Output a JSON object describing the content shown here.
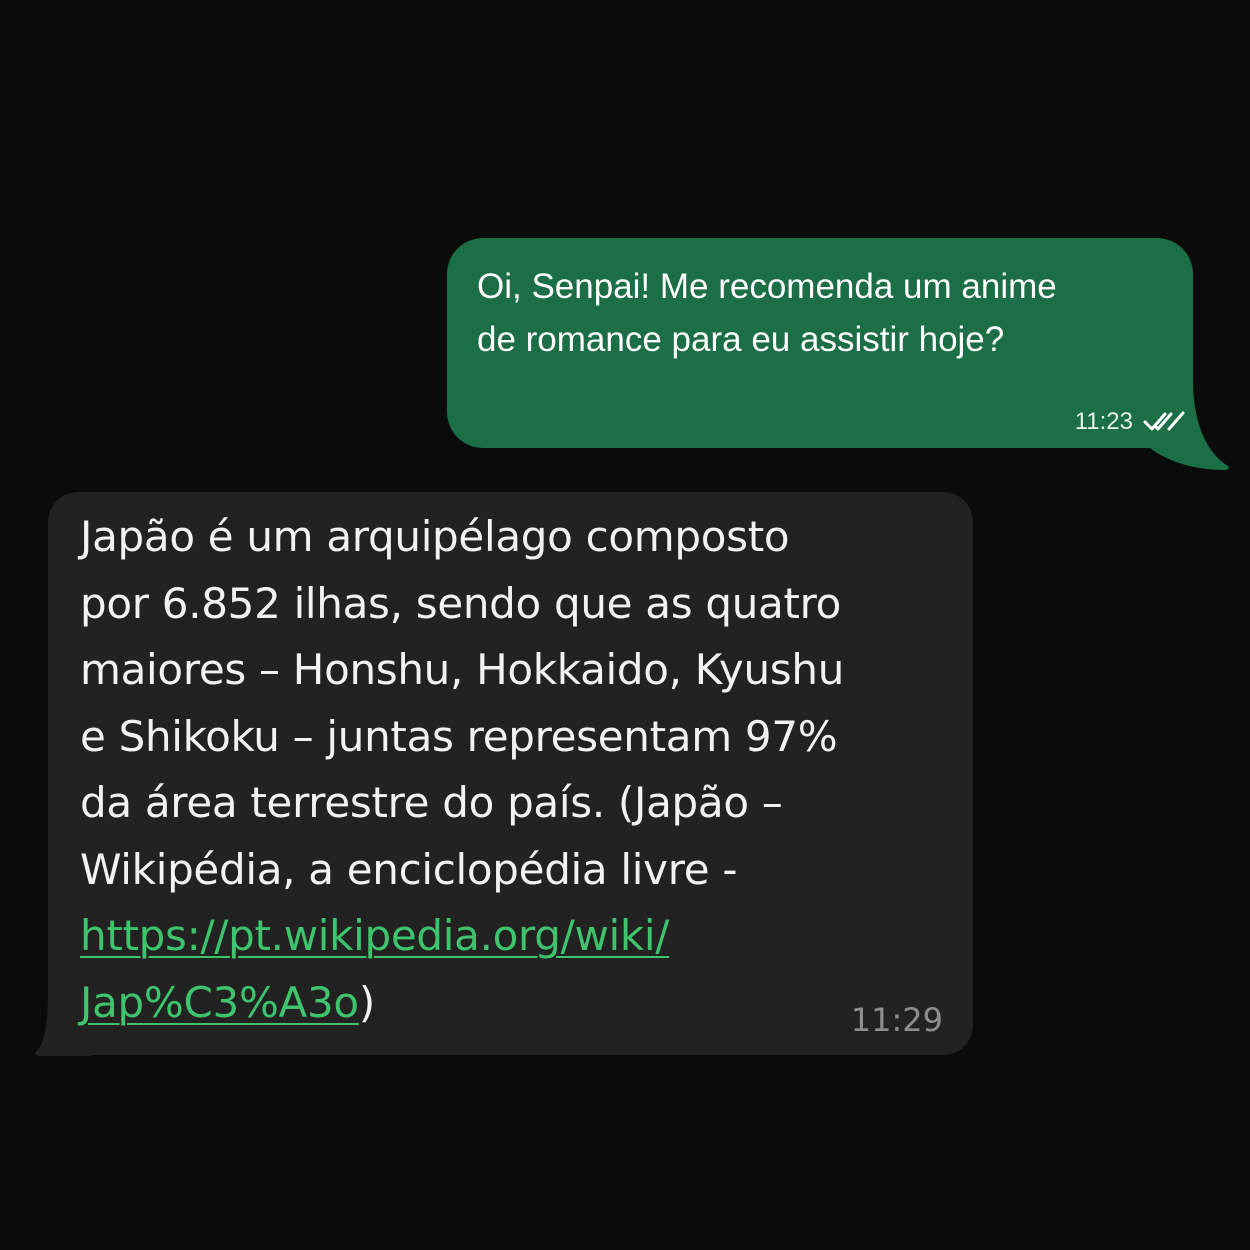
{
  "conversation": {
    "outgoing": {
      "text": "Oi, Senpai! Me recomenda um anime\nde romance para eu assistir hoje?",
      "time": "11:23",
      "status_icon": "double-check-read-icon",
      "bubble_color": "#1b6e45"
    },
    "incoming": {
      "lines": [
        "Japão é um arquipélago composto",
        "por 6.852 ilhas, sendo que as quatro",
        "maiores – Honshu, Hokkaido, Kyushu",
        "e Shikoku – juntas representam 97%",
        "da área terrestre do país. (Japão –",
        "Wikipédia, a enciclopédia livre -"
      ],
      "link_line1": "https://pt.wikipedia.org/wiki/",
      "link_line2": "Jap%C3%A3o",
      "closing": ")",
      "time": "11:29",
      "bubble_color": "#222222",
      "link_color": "#3ec46d"
    }
  }
}
